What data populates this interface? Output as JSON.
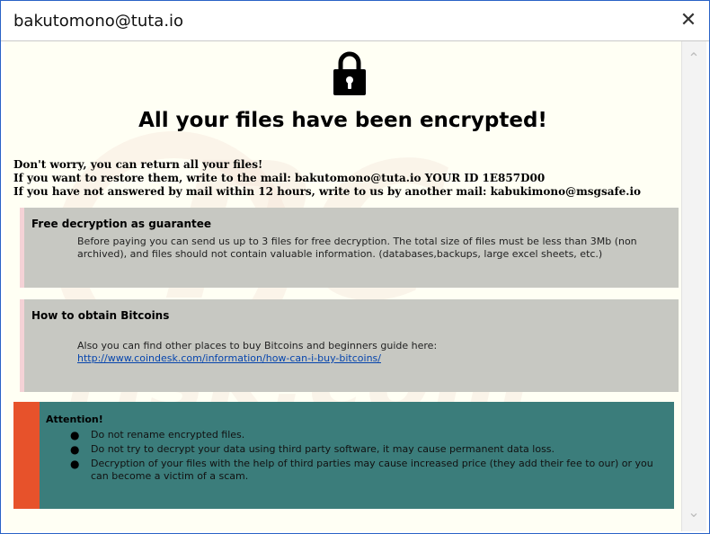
{
  "window": {
    "title": "bakutomono@tuta.io",
    "close_icon": "close-icon"
  },
  "headline": "All your files have been encrypted!",
  "intro": [
    "Don't worry, you can return all your files!",
    "If you want to restore them, write to the mail:   bakutomono@tuta.io    YOUR ID 1E857D00",
    "If you have not answered by mail within 12 hours, write to us by another mail:   kabukimono@msgsafe.io"
  ],
  "sections": {
    "free": {
      "title": "Free decryption as guarantee",
      "text": "Before paying you can send us up to 3 files for free decryption. The total size of files must be less than 3Mb (non archived), and files should not contain valuable information. (databases,backups, large excel sheets, etc.)"
    },
    "bitcoin": {
      "title": "How to obtain Bitcoins",
      "text": "Also you can find other places to buy Bitcoins and beginners guide here:",
      "link": "http://www.coindesk.com/information/how-can-i-buy-bitcoins/"
    }
  },
  "attention": {
    "title": "Attention!",
    "items": [
      "Do not rename encrypted files.",
      "Do not try to decrypt your data using third party software, it may cause permanent data loss.",
      "Decryption of your files with the help of third parties may cause increased price (they add their fee to our) or you can become a victim of a scam."
    ]
  },
  "watermark": {
    "line1": "PC",
    "line2": "risk.com"
  },
  "colors": {
    "panel_gray": "#c7c8c2",
    "attention_teal": "#3b7d7b",
    "attention_orange": "#e7522b",
    "window_border": "#2a63c6"
  },
  "icons": [
    "lock-icon",
    "close-icon",
    "scroll-up-icon",
    "scroll-down-icon"
  ]
}
